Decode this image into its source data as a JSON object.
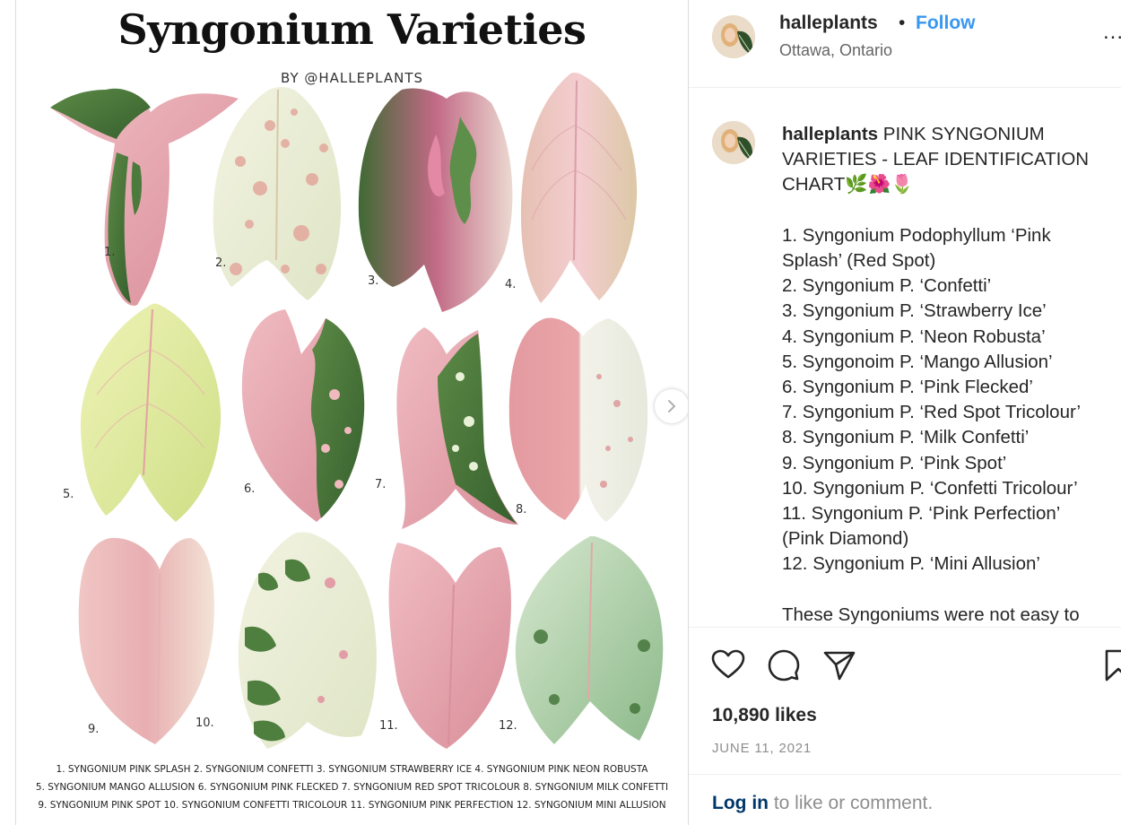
{
  "post_image": {
    "title": "Syngonium Varieties",
    "byline": "BY @HALLEPLANTS",
    "numbers": [
      "1.",
      "2.",
      "3.",
      "4.",
      "5.",
      "6.",
      "7.",
      "8.",
      "9.",
      "10.",
      "11.",
      "12."
    ],
    "caption_lines": [
      "1. SYNGONIUM PINK SPLASH 2. SYNGONIUM CONFETTI 3. SYNGONIUM STRAWBERRY ICE 4. SYNGONIUM PINK NEON ROBUSTA",
      "5. SYNGONIUM MANGO ALLUSION 6. SYNGONIUM PINK FLECKED 7. SYNGONIUM RED SPOT TRICOLOUR 8. SYNGONIUM MILK CONFETTI",
      "9. SYNGONIUM PINK SPOT 10. SYNGONIUM CONFETTI TRICOLOUR 11. SYNGONIUM PINK PERFECTION 12. SYNGONIUM MINI ALLUSION"
    ]
  },
  "header": {
    "username": "halleplants",
    "dot": "•",
    "follow_label": "Follow",
    "location": "Ottawa, Ontario",
    "more": "..."
  },
  "caption": {
    "username": "halleplants",
    "line1_rest": " PINK SYNGONIUM",
    "line2": "VARIETIES - LEAF IDENTIFICATION",
    "line3": "CHART🌿🌺🌷",
    "items": [
      "1. Syngonium Podophyllum ‘Pink",
      "Splash’ (Red Spot)",
      "2. Syngonium P. ‘Confetti’",
      "3. Syngonium P. ‘Strawberry Ice’",
      "4. Syngonium P. ‘Neon Robusta’",
      "5. Syngonoim P. ‘Mango Allusion’",
      "6. Syngonium P. ‘Pink Flecked’",
      "7. Syngonium P. ‘Red Spot Tricolour’",
      "8. Syngonium P. ‘Milk Confetti’",
      "9. Syngonium P. ‘Pink Spot’",
      "10. Syngonium P. ‘Confetti Tricolour’",
      "11. Syngonium P. ‘Pink Perfection’",
      "(Pink Diamond)",
      "12. Syngonium P. ‘Mini Allusion’"
    ],
    "more_text": "These Syngoniums were not easy to"
  },
  "actions": {
    "icons": [
      "heart-icon",
      "comment-icon",
      "share-icon",
      "bookmark-icon"
    ]
  },
  "likes": "10,890 likes",
  "date": "JUNE 11, 2021",
  "login": {
    "link": "Log in",
    "rest": " to like or comment."
  },
  "colors": {
    "link_blue": "#3897f0",
    "text": "#262626",
    "muted": "#8e8e8e",
    "leaf_pink": "#e8a0a8",
    "leaf_green": "#4c7a3c",
    "leaf_cream": "#eef0da"
  }
}
